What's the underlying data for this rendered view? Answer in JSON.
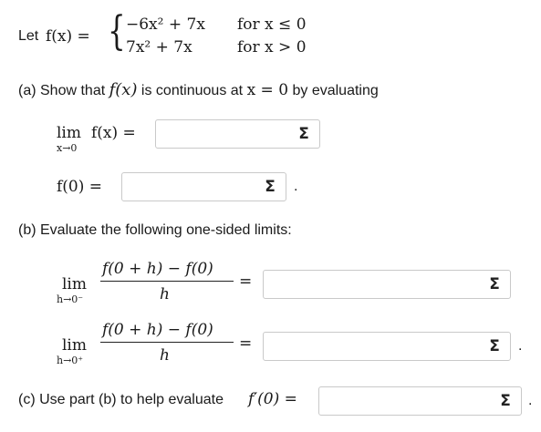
{
  "problem": {
    "let_text": "Let",
    "func": "f(x) =",
    "piece1_expr": "−6x² + 7x",
    "piece1_cond": "for x ≤ 0",
    "piece2_expr": "7x² + 7x",
    "piece2_cond": "for x > 0"
  },
  "part_a": {
    "prompt": "(a) Show that",
    "prompt_func": "f(x)",
    "prompt_mid": "is continuous at",
    "prompt_cond": "x = 0",
    "prompt_end": "by evaluating",
    "limit_word": "lim",
    "limit_sub": "x→0",
    "limit_expr": "f(x) =",
    "f0_label": "f(0) =",
    "sigma": "Σ"
  },
  "part_b": {
    "prompt": "(b) Evaluate the following one-sided limits:",
    "numerator": "f(0 + h) − f(0)",
    "denominator": "h",
    "limit_word": "lim",
    "left_sub": "h→0⁻",
    "right_sub": "h→0⁺",
    "equals": "=",
    "sigma": "Σ"
  },
  "part_c": {
    "prompt": "(c) Use part (b) to help evaluate",
    "expr": "f′(0) =",
    "sigma": "Σ"
  },
  "punctuation": {
    "period": "."
  }
}
